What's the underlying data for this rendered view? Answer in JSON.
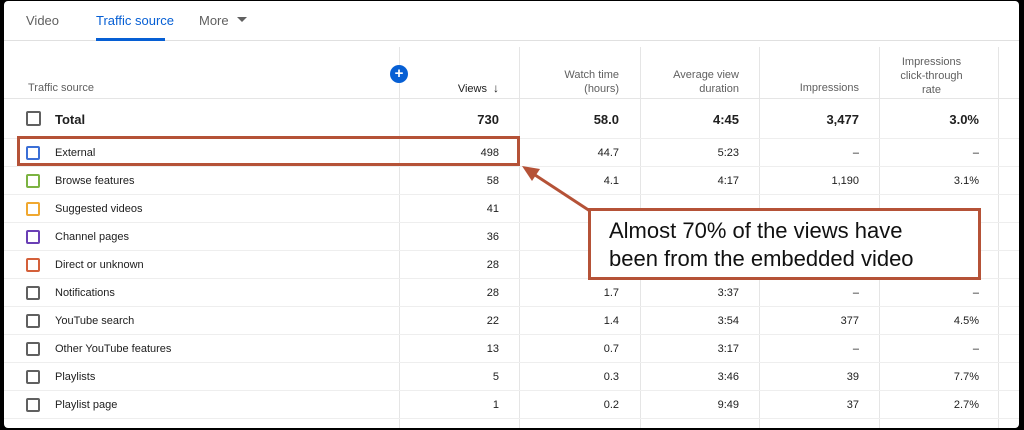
{
  "tabs": [
    {
      "label": "Video"
    },
    {
      "label": "Traffic source"
    },
    {
      "label": "More"
    }
  ],
  "headers": {
    "traffic_source": "Traffic source",
    "views": "Views",
    "sort_arrow": "↓",
    "watch_time_l1": "Watch time",
    "watch_time_l2": "(hours)",
    "avg_view_l1": "Average view",
    "avg_view_l2": "duration",
    "impressions": "Impressions",
    "ctr_l1": "Impressions",
    "ctr_l2": "click-through",
    "ctr_l3": "rate",
    "add_metric": "+"
  },
  "total": {
    "label": "Total",
    "views": "730",
    "watch": "58.0",
    "avg": "4:45",
    "impr": "3,477",
    "ctr": "3.0%"
  },
  "rows": [
    {
      "label": "External",
      "views": "498",
      "watch": "44.7",
      "avg": "5:23",
      "impr": "–",
      "ctr": "–",
      "color": "#3b6fd6"
    },
    {
      "label": "Browse features",
      "views": "58",
      "watch": "4.1",
      "avg": "4:17",
      "impr": "1,190",
      "ctr": "3.1%",
      "color": "#7cb342"
    },
    {
      "label": "Suggested videos",
      "views": "41",
      "watch": "",
      "avg": "",
      "impr": "",
      "ctr": "",
      "color": "#f0a830"
    },
    {
      "label": "Channel pages",
      "views": "36",
      "watch": "",
      "avg": "",
      "impr": "",
      "ctr": "",
      "color": "#6a3fb5"
    },
    {
      "label": "Direct or unknown",
      "views": "28",
      "watch": "",
      "avg": "",
      "impr": "",
      "ctr": "",
      "color": "#d4603a"
    },
    {
      "label": "Notifications",
      "views": "28",
      "watch": "1.7",
      "avg": "3:37",
      "impr": "–",
      "ctr": "–",
      "color": "#606060"
    },
    {
      "label": "YouTube search",
      "views": "22",
      "watch": "1.4",
      "avg": "3:54",
      "impr": "377",
      "ctr": "4.5%",
      "color": "#606060"
    },
    {
      "label": "Other YouTube features",
      "views": "13",
      "watch": "0.7",
      "avg": "3:17",
      "impr": "–",
      "ctr": "–",
      "color": "#606060"
    },
    {
      "label": "Playlists",
      "views": "5",
      "watch": "0.3",
      "avg": "3:46",
      "impr": "39",
      "ctr": "7.7%",
      "color": "#606060"
    },
    {
      "label": "Playlist page",
      "views": "1",
      "watch": "0.2",
      "avg": "9:49",
      "impr": "37",
      "ctr": "2.7%",
      "color": "#606060"
    }
  ],
  "annotation": {
    "line1": "Almost 70% of the views have",
    "line2": "been from the embedded video",
    "color": "#b55237"
  },
  "accent": "#065fd4"
}
